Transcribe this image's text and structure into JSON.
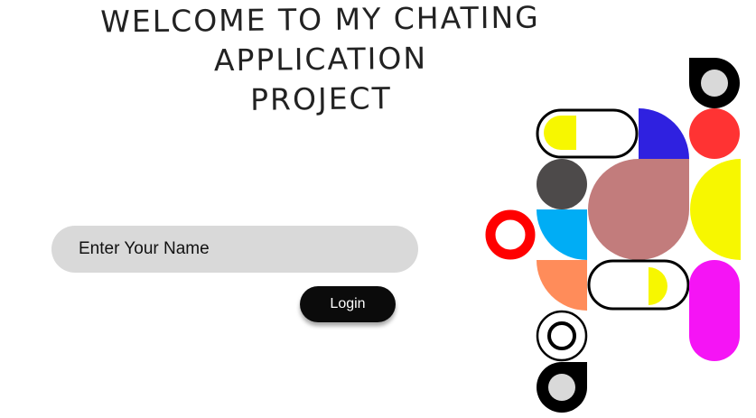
{
  "page": {
    "title_lines": [
      "WELCOME TO MY CHATING",
      "APPLICATION",
      "PROJECT"
    ]
  },
  "form": {
    "name_placeholder": "Enter Your Name",
    "login_label": "Login"
  },
  "colors": {
    "input_bg": "#d9d9d9",
    "button_bg": "#0b0b0b",
    "yellow": "#f7f700",
    "blue": "#2f21e0",
    "red": "#ff3333",
    "dark_gray": "#4d4a4a",
    "rose": "#c27c7c",
    "cyan": "#00adf5",
    "bright_red": "#ff0000",
    "orange": "#ff8c5a",
    "magenta": "#f514f5",
    "light_gray": "#d9d9d9",
    "black": "#000000"
  }
}
